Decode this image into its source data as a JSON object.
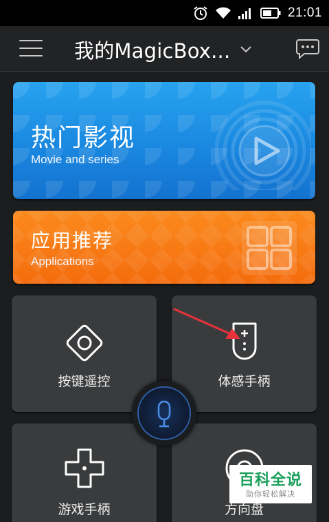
{
  "status_bar": {
    "time": "21:01",
    "icons": [
      "alarm-icon",
      "wifi-icon",
      "signal-icon",
      "battery-icon"
    ]
  },
  "header": {
    "title": "我的MagicBox...",
    "icons": [
      "menu-icon",
      "chevron-down-icon",
      "message-icon"
    ]
  },
  "cards": {
    "movie": {
      "title": "热门影视",
      "subtitle": "Movie and series",
      "icon": "play-icon"
    },
    "apps": {
      "title": "应用推荐",
      "subtitle": "Applications",
      "icon": "grid-icon"
    }
  },
  "tiles": [
    {
      "label": "按键遥控",
      "icon": "remote-diamond-icon"
    },
    {
      "label": "体感手柄",
      "icon": "motion-remote-icon"
    },
    {
      "label": "游戏手柄",
      "icon": "dpad-icon"
    },
    {
      "label": "方向盘",
      "icon": "steering-wheel-icon"
    }
  ],
  "mic": {
    "icon": "microphone-icon"
  },
  "watermark": {
    "title": "百科全说",
    "subtitle": "助你轻松解决"
  },
  "colors": {
    "movie_card": "#1a88e0",
    "apps_card": "#f46c0d",
    "tile_bg": "#3a3b3d",
    "annotation_arrow": "#e8333a",
    "watermark_green": "#1aa05a"
  }
}
